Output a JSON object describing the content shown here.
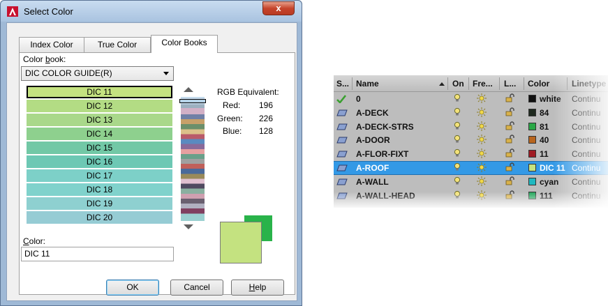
{
  "dialog": {
    "title": "Select Color",
    "close_glyph": "x",
    "tabs": [
      "Index Color",
      "True Color",
      "Color Books"
    ],
    "active_tab": "Color Books",
    "color_book_label_pre": "Color ",
    "color_book_label_u": "b",
    "color_book_label_post": "ook:",
    "color_book_value": "DIC COLOR GUIDE(R)",
    "swatches": [
      {
        "label": "DIC 11",
        "color": "#c4e280",
        "selected": true
      },
      {
        "label": "DIC 12",
        "color": "#b3dc84"
      },
      {
        "label": "DIC 13",
        "color": "#a9d88a"
      },
      {
        "label": "DIC 14",
        "color": "#8ed08e"
      },
      {
        "label": "DIC 15",
        "color": "#72c8a6"
      },
      {
        "label": "DIC 16",
        "color": "#6dc8b4"
      },
      {
        "label": "DIC 17",
        "color": "#7dd0c8"
      },
      {
        "label": "DIC 18",
        "color": "#80d2cc"
      },
      {
        "label": "DIC 19",
        "color": "#8ed0d0"
      },
      {
        "label": "DIC 20",
        "color": "#96ccd4"
      }
    ],
    "rgb": {
      "title": "RGB Equivalent:",
      "red_label": "Red:",
      "red": "196",
      "green_label": "Green:",
      "green": "226",
      "blue_label": "Blue:",
      "blue": "128"
    },
    "color_label_u": "C",
    "color_label_post": "olor:",
    "color_value": "DIC 11",
    "preview_new": "#c4e280",
    "preview_old": "#29b34a",
    "buttons": {
      "ok": "OK",
      "cancel": "Cancel",
      "help_u": "H",
      "help_post": "elp"
    }
  },
  "layers": {
    "headers": [
      "S...",
      "Name",
      "On",
      "Fre...",
      "L...",
      "Color",
      "Linetype"
    ],
    "rows": [
      {
        "name": "0",
        "color_name": "white",
        "color_hex": "#111111",
        "linetype": "Continu",
        "current": true
      },
      {
        "name": "A-DECK",
        "color_name": "84",
        "color_hex": "#1f2a1f",
        "linetype": "Continu"
      },
      {
        "name": "A-DECK-STRS",
        "color_name": "81",
        "color_hex": "#2aa846",
        "linetype": "Continu"
      },
      {
        "name": "A-DOOR",
        "color_name": "40",
        "color_hex": "#b8651e",
        "linetype": "Continu"
      },
      {
        "name": "A-FLOR-FIXT",
        "color_name": "11",
        "color_hex": "#a01c24",
        "linetype": "Continu"
      },
      {
        "name": "A-ROOF",
        "color_name": "DIC 11",
        "color_hex": "#c4e280",
        "linetype": "Continu",
        "selected": true
      },
      {
        "name": "A-WALL",
        "color_name": "cyan",
        "color_hex": "#1fb8c0",
        "linetype": "Continu"
      },
      {
        "name": "A-WALL-HEAD",
        "color_name": "111",
        "color_hex": "#22a45a",
        "linetype": "Continu"
      }
    ]
  }
}
